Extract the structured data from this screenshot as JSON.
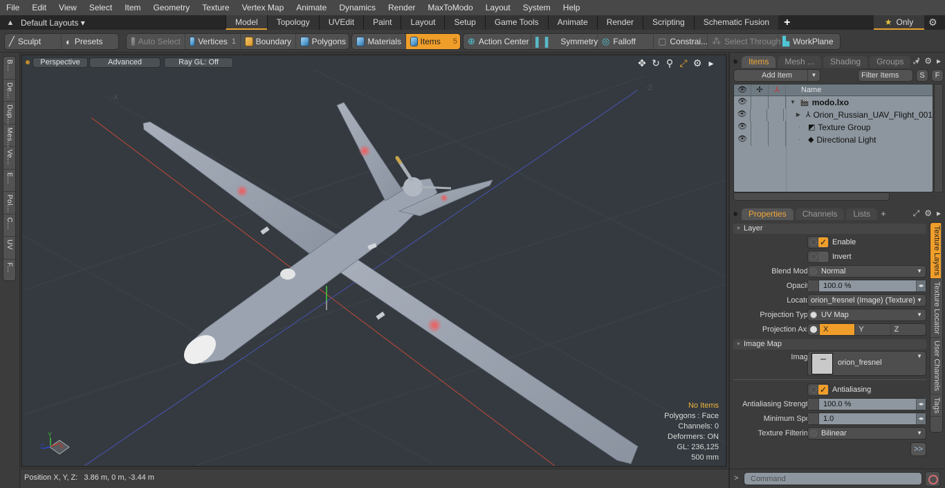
{
  "menu": [
    "File",
    "Edit",
    "View",
    "Select",
    "Item",
    "Geometry",
    "Texture",
    "Vertex Map",
    "Animate",
    "Dynamics",
    "Render",
    "MaxToModo",
    "Layout",
    "System",
    "Help"
  ],
  "layoutbar": {
    "layouts_label": "Default Layouts ▾",
    "tabs": [
      "Model",
      "Topology",
      "UVEdit",
      "Paint",
      "Layout",
      "Setup",
      "Game Tools",
      "Animate",
      "Render",
      "Scripting",
      "Schematic Fusion"
    ],
    "active_tab": "Model",
    "add_tab": "+",
    "only_label": "Only",
    "accent": "#e4a230"
  },
  "toolbar": {
    "sculpt": "Sculpt",
    "presets": "Presets",
    "auto_select": "Auto Select",
    "vertices": "Vertices",
    "vertices_count": "1",
    "boundary": "Boundary",
    "polygons": "Polygons",
    "materials": "Materials",
    "items": "Items",
    "items_count": "5",
    "action_center": "Action Center",
    "symmetry": "Symmetry",
    "falloff": "Falloff",
    "constraints": "Constrai...",
    "select_through": "Select Through",
    "workplane": "WorkPlane"
  },
  "left_tools": [
    "B...",
    "De...",
    "Dup...",
    "Mes...",
    "Ve...",
    "E...",
    "Pol...",
    "C...",
    "UV",
    "F..."
  ],
  "viewport": {
    "view_mode": "Perspective",
    "shading": "Advanced",
    "raygl": "Ray GL: Off",
    "info": {
      "selection": "No Items",
      "polygons": "Polygons : Face",
      "channels": "Channels: 0",
      "deformers": "Deformers: ON",
      "gl": "GL: 236,125",
      "grid": "500 mm"
    },
    "axis_labels": {
      "y": "Y",
      "x": "X",
      "z": "Z"
    }
  },
  "status": {
    "position_label": "Position X, Y, Z:",
    "position_value": "3.86 m, 0 m, -3.44 m"
  },
  "items_panel": {
    "tabs": [
      "Items",
      "Mesh ...",
      "Shading",
      "Groups"
    ],
    "active_tab": "Items",
    "add_item": "Add Item",
    "filter_items": "Filter Items",
    "s_btn": "S",
    "f_btn": "F",
    "name_header": "Name",
    "tree": [
      {
        "name": "modo.lxo",
        "bold": true,
        "icon": "scene-clapper-icon"
      },
      {
        "name": "Orion_Russian_UAV_Flight_001",
        "bold": false,
        "icon": "locator-axes-icon"
      },
      {
        "name": "Texture Group",
        "bold": false,
        "icon": "texture-group-icon"
      },
      {
        "name": "Directional Light",
        "bold": false,
        "icon": "directional-light-icon"
      }
    ]
  },
  "properties_panel": {
    "tabs": [
      "Properties",
      "Channels",
      "Lists"
    ],
    "active_tab": "Properties",
    "add_tab": "+",
    "layer_section": "Layer",
    "enable_label": "Enable",
    "enable_checked": true,
    "invert_label": "Invert",
    "invert_checked": false,
    "blend_mode_label": "Blend Mode",
    "blend_mode": "Normal",
    "opacity_label": "Opacity",
    "opacity": "100.0 %",
    "locator_label": "Locator",
    "locator": "orion_fresnel (Image) (Texture)",
    "projection_type_label": "Projection Type",
    "projection_type": "UV Map",
    "projection_axis_label": "Projection Axis",
    "projection_axes": [
      "X",
      "Y",
      "Z"
    ],
    "projection_axis_selected": "X",
    "image_map_section": "Image Map",
    "image_label": "Image",
    "image": "orion_fresnel",
    "antialiasing_label": "Antialiasing",
    "antialiasing_checked": true,
    "aa_strength_label": "Antialiasing Strength",
    "aa_strength": "100.0 %",
    "min_spot_label": "Minimum Spot",
    "min_spot": "1.0",
    "tex_filter_label": "Texture Filtering",
    "tex_filter": "Bilinear",
    "more": ">>",
    "side_tabs": [
      "Texture Layers",
      "Texture Locator",
      "User Channels",
      "Tags"
    ],
    "active_side_tab": "Texture Layers"
  },
  "command": {
    "prompt": ">",
    "placeholder": "Command"
  }
}
